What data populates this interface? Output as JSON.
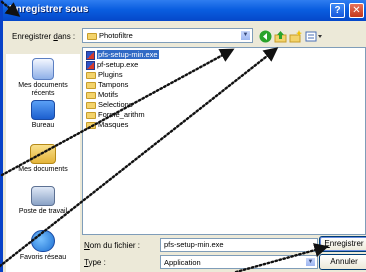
{
  "dialog": {
    "title": "Enregistrer sous",
    "help_glyph": "?",
    "close_glyph": "✕"
  },
  "save_in": {
    "label_prefix": "Enregistrer ",
    "label_accel": "d",
    "label_suffix": "ans :",
    "value": "Photofiltre"
  },
  "toolbar": {
    "icons": [
      "back-icon",
      "up-folder-icon",
      "new-folder-icon",
      "views-menu-icon"
    ]
  },
  "places": [
    {
      "label_line1": "Mes documents",
      "label_line2": "récents",
      "icon": "recent-documents-icon"
    },
    {
      "label_line1": "Bureau",
      "label_line2": "",
      "icon": "desktop-icon"
    },
    {
      "label_line1": "Mes documents",
      "label_line2": "",
      "icon": "my-documents-icon"
    },
    {
      "label_line1": "Poste de travail",
      "label_line2": "",
      "icon": "my-computer-icon"
    },
    {
      "label_line1": "Favoris réseau",
      "label_line2": "",
      "icon": "network-icon"
    }
  ],
  "files": [
    {
      "name": "pfs-setup-min.exe",
      "type": "exe",
      "selected": true
    },
    {
      "name": "pf-setup.exe",
      "type": "exe",
      "selected": false
    },
    {
      "name": "Plugins",
      "type": "folder",
      "selected": false
    },
    {
      "name": "Tampons",
      "type": "folder",
      "selected": false
    },
    {
      "name": "Motifs",
      "type": "folder",
      "selected": false
    },
    {
      "name": "Selections",
      "type": "folder",
      "selected": false
    },
    {
      "name": "Forme_arithm",
      "type": "folder",
      "selected": false
    },
    {
      "name": "Masques",
      "type": "folder",
      "selected": false
    }
  ],
  "filename": {
    "label_accel": "N",
    "label_rest": "om du fichier :",
    "value": "pfs-setup-min.exe"
  },
  "filetype": {
    "label_accel": "T",
    "label_rest": "ype :",
    "value": "Application"
  },
  "buttons": {
    "save_accel": "E",
    "save_rest": "nregistrer",
    "cancel": "Annuler"
  },
  "colors": {
    "titlebar": "#0a5ee0",
    "dialog_bg": "#ece9d8",
    "selection": "#316ac5",
    "overlay_line": "#111111"
  }
}
